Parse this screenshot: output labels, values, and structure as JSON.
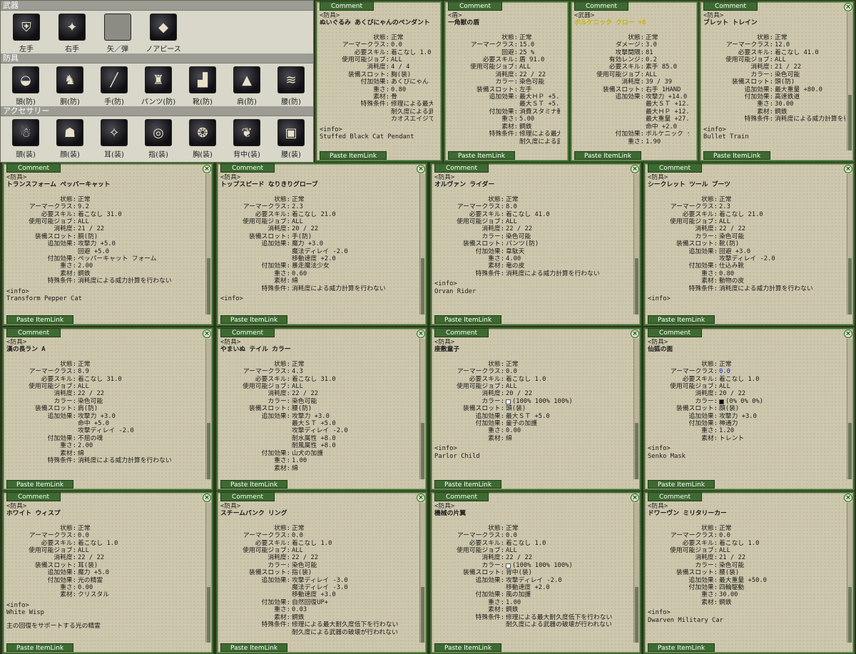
{
  "equip": {
    "sections": [
      {
        "header": "武器",
        "slots": [
          {
            "label": "左手",
            "icon": "shield-icon"
          },
          {
            "label": "右手",
            "icon": "claw-icon"
          },
          {
            "label": "矢／弾",
            "icon": "empty-slot-icon"
          },
          {
            "label": "ノアピース",
            "icon": "crystal-icon"
          }
        ]
      },
      {
        "header": "防具",
        "slots": [
          {
            "label": "頭(防)",
            "icon": "helmet-icon"
          },
          {
            "label": "胴(防)",
            "icon": "armor-icon"
          },
          {
            "label": "手(防)",
            "icon": "glove-icon"
          },
          {
            "label": "パンツ(防)",
            "icon": "pants-icon"
          },
          {
            "label": "靴(防)",
            "icon": "boots-icon"
          },
          {
            "label": "肩(防)",
            "icon": "shoulder-icon"
          },
          {
            "label": "腰(防)",
            "icon": "waist-icon"
          }
        ]
      },
      {
        "header": "アクセサリー",
        "slots": [
          {
            "label": "頭(装)",
            "icon": "doll-icon"
          },
          {
            "label": "顔(装)",
            "icon": "mask-icon"
          },
          {
            "label": "耳(装)",
            "icon": "wisp-icon"
          },
          {
            "label": "指(装)",
            "icon": "ring-icon"
          },
          {
            "label": "胸(装)",
            "icon": "pendant-icon"
          },
          {
            "label": "背中(装)",
            "icon": "wing-icon"
          },
          {
            "label": "腰(装)",
            "icon": "car-icon"
          }
        ]
      }
    ]
  },
  "common": {
    "tab": "Comment",
    "paste": "Paste ItemLink",
    "close": "×"
  },
  "windows": [
    {
      "kind": "<防具>",
      "name": "ぬいぐるみ あくびにゃんのペンダント",
      "props": [
        [
          "状態:",
          "正常"
        ],
        [
          "アーマークラス:",
          "0.0"
        ],
        [
          "必要スキル:",
          "着こなし 1.0"
        ],
        [
          "使用可能ジョブ:",
          "ALL"
        ],
        [
          "消耗度:",
          "4 / 4"
        ],
        [
          "装備スロット:",
          "胸(装)"
        ],
        [
          "付加効果:",
          "あくびにゃん フォ"
        ],
        [
          "重さ:",
          "0.80"
        ],
        [
          "素材:",
          "骨"
        ],
        [
          "特殊条件:",
          "修理による最大"
        ],
        [
          "",
          "耐久度による武器"
        ],
        [
          "",
          "カオスエイジで"
        ]
      ],
      "info": "<info>",
      "info_text": "Stuffed Black Cat Pendant"
    },
    {
      "kind": "<盾>",
      "name": "一角獣の盾",
      "props": [
        [
          "状態:",
          "正常"
        ],
        [
          "アーマークラス:",
          "15.0"
        ],
        [
          "回避:",
          "25 %"
        ],
        [
          "必要スキル:",
          "盾 91.0"
        ],
        [
          "使用可能ジョブ:",
          "ALL"
        ],
        [
          "消耗度:",
          "22 / 22"
        ],
        [
          "カラー:",
          "染色可能"
        ],
        [
          "装備スロット:",
          "左手"
        ],
        [
          "追加効果:",
          "最大ＨＰ +5.0"
        ],
        [
          "",
          "最大ＳＴ +5.0"
        ],
        [
          "付加効果:",
          "消費スタミナ軽"
        ],
        [
          "重さ:",
          "5.00"
        ],
        [
          "素材:",
          "鋼鉄"
        ],
        [
          "特殊条件:",
          "修理による最大"
        ],
        [
          "",
          "耐久度による武"
        ]
      ],
      "info": "",
      "info_text": ""
    },
    {
      "kind": "<武器>",
      "name": "ボルケニック クロー +8",
      "props": [
        [
          "状態:",
          "正常"
        ],
        [
          "ダメージ:",
          "3.0"
        ],
        [
          "攻撃間隔:",
          "81"
        ],
        [
          "有効レンジ:",
          "0.2"
        ],
        [
          "必要スキル:",
          "素手 85.0"
        ],
        [
          "使用可能ジョブ:",
          "ALL"
        ],
        [
          "消耗度:",
          "39 / 39"
        ],
        [
          "装備スロット:",
          "右手 1HAND"
        ],
        [
          "追加効果:",
          "攻撃力 +14.0"
        ],
        [
          "",
          "最大ＳＴ +12.0"
        ],
        [
          "",
          "最大ＨＰ +12.0"
        ],
        [
          "",
          "最大重量 +27.0"
        ],
        [
          "",
          "命中 +2.0"
        ],
        [
          "付加効果:",
          "ボルケニック ク"
        ],
        [
          "重さ:",
          "1.90"
        ]
      ],
      "info": "",
      "info_text": ""
    },
    {
      "kind": "<防具>",
      "name": "ブレット トレイン",
      "props": [
        [
          "状態:",
          "正常"
        ],
        [
          "アーマークラス:",
          "12.0"
        ],
        [
          "必要スキル:",
          "着こなし 41.0"
        ],
        [
          "使用可能ジョブ:",
          "ALL"
        ],
        [
          "消耗度:",
          "21 / 22"
        ],
        [
          "カラー:",
          "染色可能"
        ],
        [
          "装備スロット:",
          "頭(防)"
        ],
        [
          "追加効果:",
          "最大重量 +80.0"
        ],
        [
          "付加効果:",
          "高速鉄道"
        ],
        [
          "重さ:",
          "30.00"
        ],
        [
          "素材:",
          "鋼鉄"
        ],
        [
          "特殊条件:",
          "消耗度による威力計算を行わな"
        ]
      ],
      "info": "<info>",
      "info_text": "Bullet Train"
    },
    {
      "kind": "<防具>",
      "name": "トランスフォーム ペッパーキャット",
      "props": [
        [
          "状態:",
          "正常"
        ],
        [
          "アーマークラス:",
          "9.2"
        ],
        [
          "必要スキル:",
          "着こなし 31.0"
        ],
        [
          "使用可能ジョブ:",
          "ALL"
        ],
        [
          "消耗度:",
          "21 / 22"
        ],
        [
          "装備スロット:",
          "胴(防)"
        ],
        [
          "追加効果:",
          "攻撃力 +5.0"
        ],
        [
          "",
          "回避 +5.0"
        ],
        [
          "付加効果:",
          "ペッパーキャット フォーム"
        ],
        [
          "重さ:",
          "2.00"
        ],
        [
          "素材:",
          "鋼鉄"
        ],
        [
          "特殊条件:",
          "消耗度による威力計算を行わない"
        ]
      ],
      "info": "<info>",
      "info_text": "Transform Pepper Cat"
    },
    {
      "kind": "<防具>",
      "name": "トップスピード なりきりグローブ",
      "props": [
        [
          "状態:",
          "正常"
        ],
        [
          "アーマークラス:",
          "2.3"
        ],
        [
          "必要スキル:",
          "着こなし 21.0"
        ],
        [
          "使用可能ジョブ:",
          "ALL"
        ],
        [
          "消耗度:",
          "20 / 22"
        ],
        [
          "装備スロット:",
          "手(防)"
        ],
        [
          "追加効果:",
          "魔力 +3.0"
        ],
        [
          "",
          "魔法ディレイ -2.0"
        ],
        [
          "",
          "移動速度 +2.0"
        ],
        [
          "付加効果:",
          "暴走魔法少女"
        ],
        [
          "重さ:",
          "0.60"
        ],
        [
          "素材:",
          "綿"
        ],
        [
          "特殊条件:",
          "消耗度による威力計算を行わない"
        ]
      ],
      "info": "<info>",
      "info_text": ""
    },
    {
      "kind": "<防具>",
      "name": "オルヴァン ライダー",
      "props": [
        [
          "状態:",
          "正常"
        ],
        [
          "アーマークラス:",
          "8.0"
        ],
        [
          "必要スキル:",
          "着こなし 41.0"
        ],
        [
          "使用可能ジョブ:",
          "ALL"
        ],
        [
          "消耗度:",
          "22 / 22"
        ],
        [
          "カラー:",
          "染色可能"
        ],
        [
          "装備スロット:",
          "パンツ(防)"
        ],
        [
          "付加効果:",
          "韋駄天"
        ],
        [
          "重さ:",
          "4.00"
        ],
        [
          "素材:",
          "竜の皮"
        ],
        [
          "特殊条件:",
          "消耗度による威力計算を行わない"
        ]
      ],
      "info": "<info>",
      "info_text": "Orvan Rider"
    },
    {
      "kind": "<防具>",
      "name": "シークレット ツール ブーツ",
      "props": [
        [
          "状態:",
          "正常"
        ],
        [
          "アーマークラス:",
          "2.3"
        ],
        [
          "必要スキル:",
          "着こなし 21.0"
        ],
        [
          "使用可能ジョブ:",
          "ALL"
        ],
        [
          "消耗度:",
          "22 / 22"
        ],
        [
          "カラー:",
          "染色可能"
        ],
        [
          "装備スロット:",
          "靴(防)"
        ],
        [
          "追加効果:",
          "回避 +3.0"
        ],
        [
          "",
          "攻撃ディレイ -2.0"
        ],
        [
          "付加効果:",
          "仕込み靴"
        ],
        [
          "重さ:",
          "0.80"
        ],
        [
          "素材:",
          "動物の皮"
        ],
        [
          "特殊条件:",
          "消耗度による威力計算を行わない"
        ]
      ],
      "info": "<info>",
      "info_text": ""
    },
    {
      "kind": "<防具>",
      "name": "漢の長ラン A",
      "props": [
        [
          "状態:",
          "正常"
        ],
        [
          "アーマークラス:",
          "8.9"
        ],
        [
          "必要スキル:",
          "着こなし 31.0"
        ],
        [
          "使用可能ジョブ:",
          "ALL"
        ],
        [
          "消耗度:",
          "22 / 22"
        ],
        [
          "カラー:",
          "染色可能"
        ],
        [
          "装備スロット:",
          "肩(防)"
        ],
        [
          "追加効果:",
          "攻撃力 +3.0"
        ],
        [
          "",
          "命中 +5.0"
        ],
        [
          "",
          "攻撃ディレイ -2.0"
        ],
        [
          "付加効果:",
          "不屈の魂"
        ],
        [
          "重さ:",
          "2.00"
        ],
        [
          "素材:",
          "綿"
        ],
        [
          "特殊条件:",
          "消耗度による威力計算を行わない"
        ]
      ],
      "info": "",
      "info_text": ""
    },
    {
      "kind": "<防具>",
      "name": "やまいぬ テイル カラー",
      "props": [
        [
          "状態:",
          "正常"
        ],
        [
          "アーマークラス:",
          "4.3"
        ],
        [
          "必要スキル:",
          "着こなし 31.0"
        ],
        [
          "使用可能ジョブ:",
          "ALL"
        ],
        [
          "消耗度:",
          "22 / 22"
        ],
        [
          "カラー:",
          "染色可能"
        ],
        [
          "装備スロット:",
          "腰(防)"
        ],
        [
          "追加効果:",
          "攻撃力 +3.0"
        ],
        [
          "",
          "最大ＳＴ +5.0"
        ],
        [
          "",
          "攻撃ディレイ -2.0"
        ],
        [
          "",
          "耐水属性 +8.0"
        ],
        [
          "",
          "耐風属性 +8.0"
        ],
        [
          "付加効果:",
          "山犬の加護"
        ],
        [
          "重さ:",
          "1.00"
        ],
        [
          "素材:",
          "綿"
        ]
      ],
      "info": "",
      "info_text": ""
    },
    {
      "kind": "<防具>",
      "name": "座敷童子",
      "props": [
        [
          "状態:",
          "正常"
        ],
        [
          "アーマークラス:",
          "0.0"
        ],
        [
          "必要スキル:",
          "着こなし 1.0"
        ],
        [
          "使用可能ジョブ:",
          "ALL"
        ],
        [
          "消耗度:",
          "20 / 22"
        ],
        [
          "カラー:",
          "(100% 100% 100%)",
          "swatch-white"
        ],
        [
          "装備スロット:",
          "頭(装)"
        ],
        [
          "追加効果:",
          "最大ＳＴ +5.0"
        ],
        [
          "付加効果:",
          "童子の加護"
        ],
        [
          "重さ:",
          "0.00"
        ],
        [
          "素材:",
          "綿"
        ]
      ],
      "info": "<info>",
      "info_text": "Parlor Child"
    },
    {
      "kind": "<防具>",
      "name": "仙狐の面",
      "props": [
        [
          "状態:",
          "正常"
        ],
        [
          "アーマークラス:",
          "0.0",
          "blue"
        ],
        [
          "必要スキル:",
          "着こなし 1.0"
        ],
        [
          "使用可能ジョブ:",
          "ALL"
        ],
        [
          "消耗度:",
          "20 / 22"
        ],
        [
          "カラー:",
          "(0% 0% 0%)",
          "swatch-black"
        ],
        [
          "装備スロット:",
          "顔(装)"
        ],
        [
          "追加効果:",
          "攻撃力 +3.0"
        ],
        [
          "付加効果:",
          "神通力"
        ],
        [
          "重さ:",
          "1.20"
        ],
        [
          "素材:",
          "トレント"
        ]
      ],
      "info": "<info>",
      "info_text": "Senko Mask"
    },
    {
      "kind": "<防具>",
      "name": "ホワイト ウィスプ",
      "props": [
        [
          "状態:",
          "正常"
        ],
        [
          "アーマークラス:",
          "0.0"
        ],
        [
          "必要スキル:",
          "着こなし 1.0"
        ],
        [
          "使用可能ジョブ:",
          "ALL"
        ],
        [
          "消耗度:",
          "22 / 22"
        ],
        [
          "装備スロット:",
          "耳(装)"
        ],
        [
          "追加効果:",
          "魔力 +5.0"
        ],
        [
          "付加効果:",
          "光の精霊"
        ],
        [
          "重さ:",
          "0.00"
        ],
        [
          "素材:",
          "クリスタル"
        ]
      ],
      "info": "<info>",
      "info_text": "White Wisp",
      "note": "主の回復をサポートする光の精霊"
    },
    {
      "kind": "<防具>",
      "name": "スチームパンク リング",
      "props": [
        [
          "状態:",
          "正常"
        ],
        [
          "アーマークラス:",
          "0.0"
        ],
        [
          "必要スキル:",
          "着こなし 1.0"
        ],
        [
          "使用可能ジョブ:",
          "ALL"
        ],
        [
          "消耗度:",
          "22 / 22"
        ],
        [
          "カラー:",
          "染色可能"
        ],
        [
          "装備スロット:",
          "指(装)"
        ],
        [
          "追加効果:",
          "攻撃ディレイ -3.0"
        ],
        [
          "",
          "魔法ディレイ -3.0"
        ],
        [
          "",
          "移動速度 +3.0"
        ],
        [
          "付加効果:",
          "自然回復UP+"
        ],
        [
          "重さ:",
          "0.03"
        ],
        [
          "素材:",
          "鋼鉄"
        ],
        [
          "特殊条件:",
          "修理による最大耐久度低下を行わない"
        ],
        [
          "",
          "耐久度による武器の破壊が行われない"
        ]
      ],
      "info": "",
      "info_text": ""
    },
    {
      "kind": "<防具>",
      "name": "機械の片翼",
      "props": [
        [
          "状態:",
          "正常"
        ],
        [
          "アーマークラス:",
          "0.0"
        ],
        [
          "必要スキル:",
          "着こなし 1.0"
        ],
        [
          "使用可能ジョブ:",
          "ALL"
        ],
        [
          "消耗度:",
          "22 / 22"
        ],
        [
          "カラー:",
          "(100% 100% 100%)",
          "swatch-white"
        ],
        [
          "装備スロット:",
          "背中(装)"
        ],
        [
          "追加効果:",
          "攻撃ディレイ -2.0"
        ],
        [
          "",
          "移動速度 +2.0"
        ],
        [
          "付加効果:",
          "風の加護"
        ],
        [
          "重さ:",
          "1.00"
        ],
        [
          "素材:",
          "鋼鉄"
        ],
        [
          "特殊条件:",
          "修理による最大耐久度低下を行わない"
        ],
        [
          "",
          "耐久度による武器の破壊が行われない"
        ]
      ],
      "info": "",
      "info_text": ""
    },
    {
      "kind": "<防具>",
      "name": "ドワーヴン ミリタリーカー",
      "props": [
        [
          "状態:",
          "正常"
        ],
        [
          "アーマークラス:",
          "0.0"
        ],
        [
          "必要スキル:",
          "着こなし 1.0"
        ],
        [
          "使用可能ジョブ:",
          "ALL"
        ],
        [
          "消耗度:",
          "21 / 22"
        ],
        [
          "カラー:",
          "染色可能"
        ],
        [
          "装備スロット:",
          "腰(装)"
        ],
        [
          "追加効果:",
          "最大重量 +50.0"
        ],
        [
          "付加効果:",
          "四輪駆動"
        ],
        [
          "重さ:",
          "30.00"
        ],
        [
          "素材:",
          "鋼鉄"
        ]
      ],
      "info": "<info>",
      "info_text": "Dwarven Military Car"
    }
  ]
}
